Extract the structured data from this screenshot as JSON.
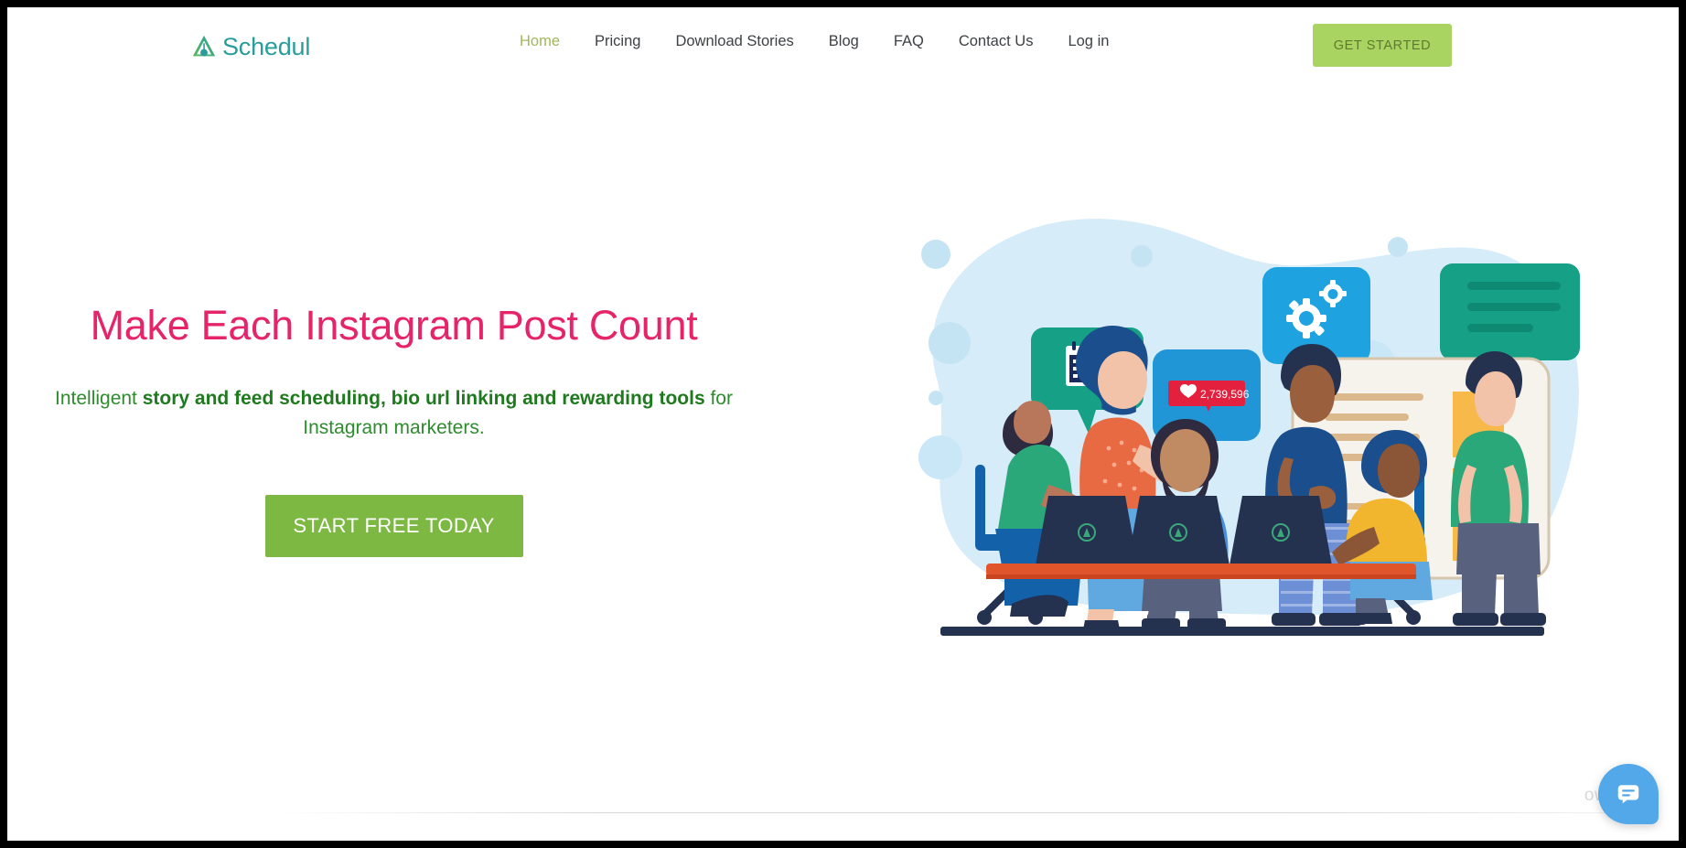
{
  "brand": {
    "name": "Schedul",
    "logo_icon": "ai-triangle-logo-icon",
    "logo_color_start": "#6cbf6a",
    "logo_color_end": "#2a9d9b",
    "text_color": "#2a9d9b"
  },
  "nav": {
    "items": [
      {
        "label": "Home",
        "active": true
      },
      {
        "label": "Pricing",
        "active": false
      },
      {
        "label": "Download Stories",
        "active": false
      },
      {
        "label": "Blog",
        "active": false
      },
      {
        "label": "FAQ",
        "active": false
      },
      {
        "label": "Contact Us",
        "active": false
      },
      {
        "label": "Log in",
        "active": false
      }
    ],
    "active_color": "#9fb75c",
    "inactive_color": "#3d4145",
    "cta": {
      "label": "GET STARTED",
      "background": "#aad462",
      "text_color": "#5c7a2e"
    }
  },
  "hero": {
    "title": "Make Each Instagram Post Count",
    "title_color": "#e6246a",
    "subtitle": {
      "lead": "Intelligent ",
      "emphasis": "story and feed scheduling, bio url linking and rewarding tools",
      "tail": " for Instagram marketers.",
      "color": "#2e8b2e"
    },
    "cta": {
      "label": "START FREE TODAY",
      "background": "#7cb842",
      "text_color": "#ffffff"
    }
  },
  "illustration": {
    "name": "team-collaboration-illustration",
    "blob_color": "#d3ecf7",
    "bubbles": [
      {
        "icon": "calendar-icon",
        "color": "#16a085",
        "label": ""
      },
      {
        "icon": "heart-like-counter-icon",
        "color": "#2196d6",
        "label": "2,739,596",
        "badge_color": "#e3213f"
      },
      {
        "icon": "gears-settings-icon",
        "color": "#1fa3e0",
        "label": ""
      },
      {
        "icon": "text-lines-message-icon",
        "color": "#16a085",
        "label": ""
      }
    ],
    "desk_color": "#e1552a",
    "laptop_color": "#24314f",
    "whiteboard_color": "#f4f1ec",
    "sticky_note_color": "#f7b94a"
  },
  "chat": {
    "icon": "chat-message-icon",
    "color": "#52a8e8"
  },
  "watermark": {
    "text": "ows."
  }
}
